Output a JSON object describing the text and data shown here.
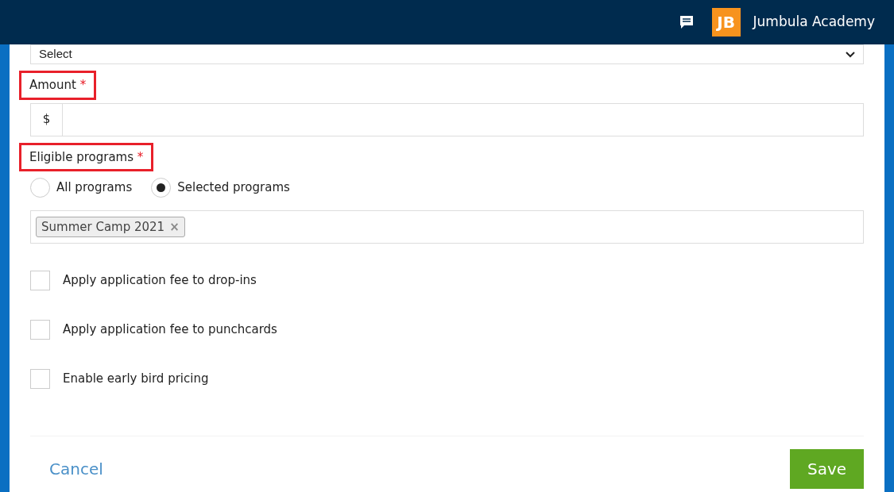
{
  "header": {
    "logo": "JB",
    "org_name": "Jumbula Academy"
  },
  "select": {
    "value": "Select"
  },
  "amount": {
    "label": "Amount",
    "required_mark": "*",
    "highlighted": true,
    "prefix": "$"
  },
  "eligible": {
    "label": "Eligible programs",
    "required_mark": "*",
    "highlighted": true,
    "options": [
      {
        "label": "All programs",
        "selected": false
      },
      {
        "label": "Selected programs",
        "selected": true
      }
    ],
    "tags": [
      {
        "label": "Summer Camp 2021",
        "remove": "×"
      }
    ]
  },
  "checkboxes": [
    {
      "label": "Apply application fee to drop-ins",
      "checked": false
    },
    {
      "label": "Apply application fee to punchcards",
      "checked": false
    },
    {
      "label": "Enable early bird pricing",
      "checked": false
    }
  ],
  "footer": {
    "cancel": "Cancel",
    "save": "Save"
  }
}
